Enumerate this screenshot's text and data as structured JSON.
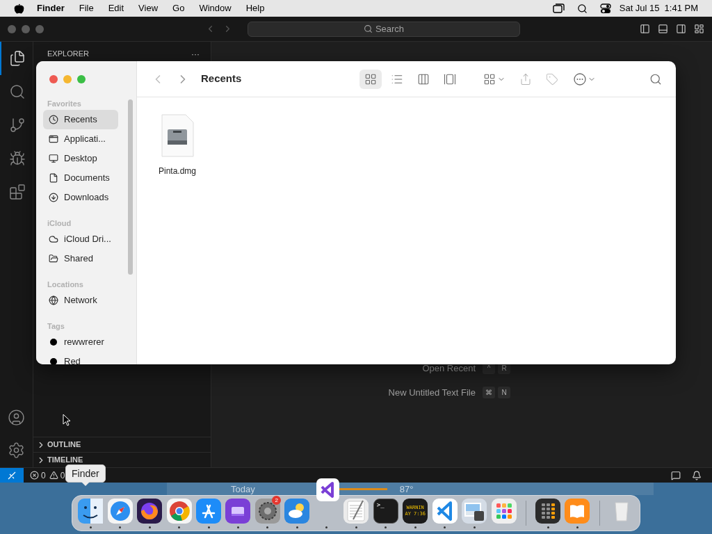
{
  "menu_bar": {
    "items": [
      {
        "label": "Finder",
        "kind": "app"
      },
      {
        "label": "File",
        "kind": "menu"
      },
      {
        "label": "Edit",
        "kind": "menu"
      },
      {
        "label": "View",
        "kind": "menu"
      },
      {
        "label": "Go",
        "kind": "menu"
      },
      {
        "label": "Window",
        "kind": "menu"
      },
      {
        "label": "Help",
        "kind": "menu"
      }
    ],
    "date": "Sat Jul 15",
    "time": "1:41 PM"
  },
  "editor_window": {
    "search": {
      "placeholder": "Search"
    },
    "activity_bar": [
      {
        "kind": "explorer",
        "selected": true
      },
      {
        "kind": "search",
        "selected": false
      },
      {
        "kind": "source-control",
        "selected": false
      },
      {
        "kind": "run",
        "selected": false
      },
      {
        "kind": "extensions",
        "selected": false
      }
    ],
    "sidebar_title": "EXPLORER",
    "sidebar_more": "···",
    "sections": [
      {
        "label": "OUTLINE",
        "expanded": false
      },
      {
        "label": "TIMELINE",
        "expanded": false
      }
    ],
    "shortcuts": [
      {
        "label": "Open Recent",
        "keys": [
          "^",
          "R"
        ]
      },
      {
        "label": "New Untitled Text File",
        "keys": [
          "⌘",
          "N"
        ]
      }
    ],
    "status_bar": {
      "errors": "0",
      "warnings": "0"
    }
  },
  "finder": {
    "title": "Recents",
    "view_modes": [
      {
        "kind": "icons",
        "selected": true
      },
      {
        "kind": "list",
        "selected": false
      },
      {
        "kind": "columns",
        "selected": false
      },
      {
        "kind": "gallery",
        "selected": false
      }
    ],
    "sidebar": [
      {
        "heading": "Favorites",
        "items": [
          {
            "label": "Recents",
            "kind": "recents",
            "selected": true
          },
          {
            "label": "Applicati...",
            "kind": "applications",
            "selected": false
          },
          {
            "label": "Desktop",
            "kind": "desktop",
            "selected": false
          },
          {
            "label": "Documents",
            "kind": "documents",
            "selected": false
          },
          {
            "label": "Downloads",
            "kind": "downloads",
            "selected": false
          }
        ]
      },
      {
        "heading": "iCloud",
        "items": [
          {
            "label": "iCloud Dri...",
            "kind": "icloud",
            "selected": false
          },
          {
            "label": "Shared",
            "kind": "shared",
            "selected": false
          }
        ]
      },
      {
        "heading": "Locations",
        "items": [
          {
            "label": "Network",
            "kind": "network",
            "selected": false
          }
        ]
      },
      {
        "heading": "Tags",
        "items": [
          {
            "label": "rewwrerer",
            "kind": "tag",
            "color": "#000000",
            "selected": false
          },
          {
            "label": "Red",
            "kind": "tag",
            "color": "#000000",
            "selected": false
          }
        ]
      }
    ],
    "files": [
      {
        "name": "Pinta.dmg"
      }
    ]
  },
  "weather": {
    "day": "Today",
    "temperature": "87°"
  },
  "tooltip": "Finder",
  "dock": [
    {
      "kind": "finder",
      "running": true
    },
    {
      "kind": "safari",
      "running": true
    },
    {
      "kind": "firefox",
      "running": true
    },
    {
      "kind": "chrome",
      "running": true
    },
    {
      "kind": "appstore",
      "running": true
    },
    {
      "kind": "purple",
      "running": true
    },
    {
      "kind": "settings",
      "running": true,
      "badge": "2"
    },
    {
      "kind": "weather",
      "running": true
    },
    {
      "kind": "empty",
      "running": true
    },
    {
      "kind": "textedit",
      "running": true
    },
    {
      "kind": "terminal",
      "running": true,
      "glyph": ">_"
    },
    {
      "kind": "console",
      "running": true,
      "lines": [
        "WARNIN",
        "AY 7:36"
      ]
    },
    {
      "kind": "vscode",
      "running": true
    },
    {
      "kind": "preview",
      "running": true
    },
    {
      "kind": "launchpad",
      "running": false
    },
    {
      "kind": "separator"
    },
    {
      "kind": "calculator",
      "running": true
    },
    {
      "kind": "books",
      "running": true
    },
    {
      "kind": "separator"
    },
    {
      "kind": "trash",
      "running": false
    }
  ],
  "dragged_icon": {
    "kind": "visualstudio"
  }
}
